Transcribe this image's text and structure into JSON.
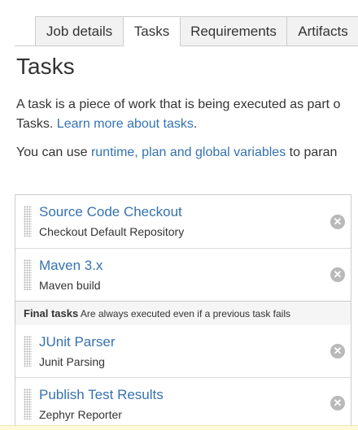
{
  "tabs": [
    {
      "label": "Job details",
      "active": false
    },
    {
      "label": "Tasks",
      "active": true
    },
    {
      "label": "Requirements",
      "active": false
    },
    {
      "label": "Artifacts",
      "active": false
    }
  ],
  "page": {
    "title": "Tasks",
    "intro_text": "A task is a piece of work that is being executed as part o",
    "intro_text2": "Tasks. ",
    "learn_more_link": "Learn more about tasks",
    "intro_end": ".",
    "vars_prefix": "You can use ",
    "vars_link": "runtime, plan and global variables",
    "vars_suffix": " to paran"
  },
  "tasks": [
    {
      "title": "Source Code Checkout",
      "description": "Checkout Default Repository"
    },
    {
      "title": "Maven 3.x",
      "description": "Maven build"
    }
  ],
  "final_tasks": {
    "label": "Final tasks",
    "note": "Are always executed even if a previous task fails",
    "items": [
      {
        "title": "JUnit Parser",
        "description": "Junit Parsing"
      },
      {
        "title": "Publish Test Results",
        "description": "Zephyr Reporter"
      }
    ]
  },
  "icons": {
    "drag": "drag-handle-icon",
    "delete": "remove-icon"
  },
  "colors": {
    "link": "#3572b0",
    "text": "#333333",
    "border": "#cccccc",
    "delete_icon": "#b9b9b9"
  }
}
